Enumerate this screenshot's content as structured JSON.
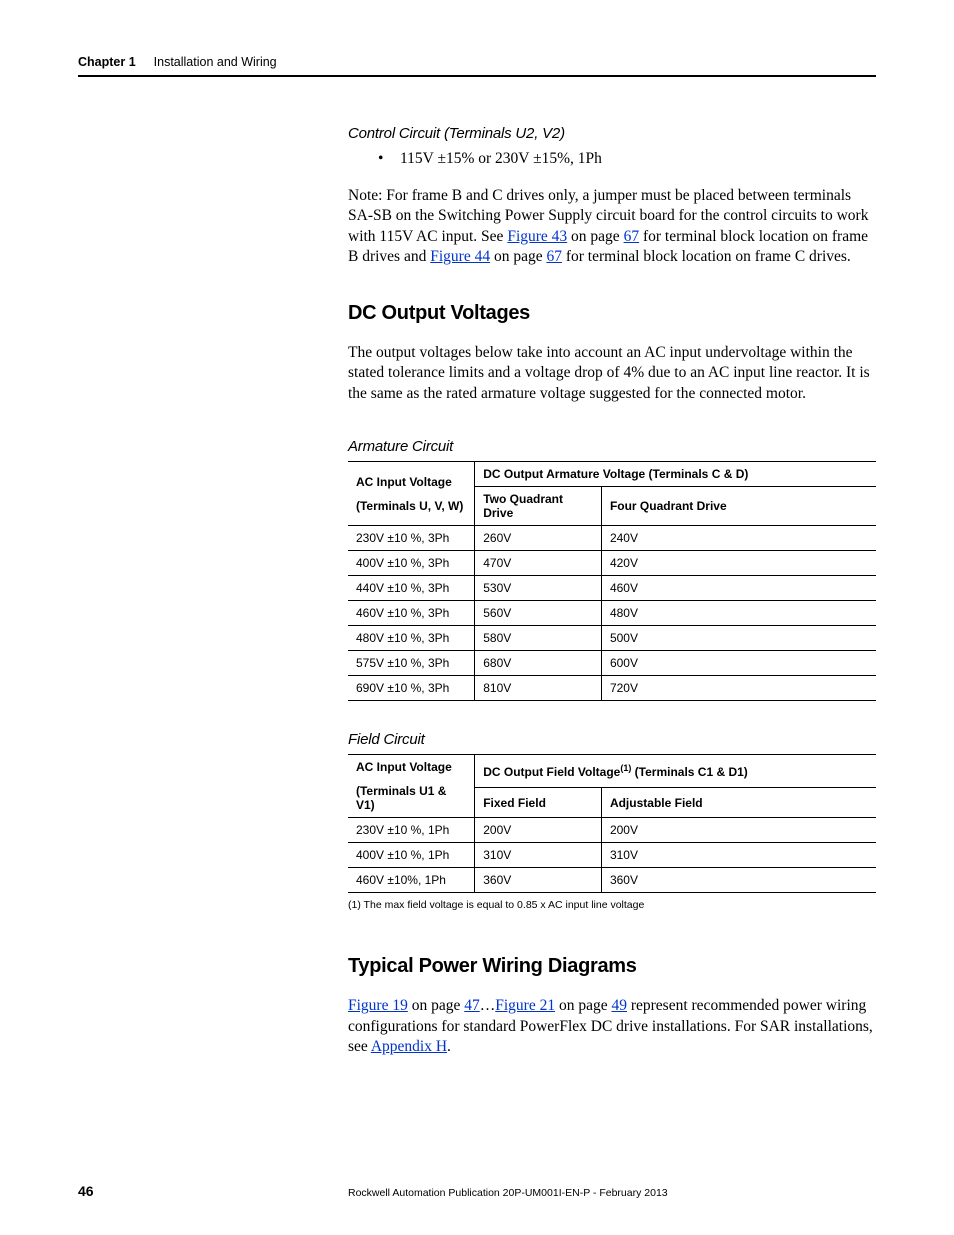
{
  "header": {
    "chapter": "Chapter 1",
    "title": "Installation and Wiring"
  },
  "controlCircuit": {
    "heading": "Control Circuit (Terminals U2, V2)",
    "bullet": "115V ±15% or 230V ±15%, 1Ph"
  },
  "note": {
    "pre1": "Note: For frame B and C drives only, a jumper must be placed between terminals SA-SB on the Switching Power Supply circuit board for the control circuits to work with 115V AC input. See ",
    "link1": "Figure 43",
    "mid1": " on page ",
    "page1": "67",
    "mid2": " for terminal block location on frame B drives and ",
    "link2": "Figure 44",
    "mid3": " on page ",
    "page2": "67",
    "post": " for terminal block location on frame C drives."
  },
  "dcOut": {
    "heading": "DC Output Voltages",
    "para": "The output voltages below take into account an AC input undervoltage within the stated tolerance limits and a voltage drop of 4% due to an AC input line reactor. It is the same as the rated armature voltage suggested for the connected motor."
  },
  "armature": {
    "heading": "Armature Circuit",
    "h1": "AC Input Voltage",
    "h1sub": "(Terminals U, V, W)",
    "h2": "DC Output Armature Voltage (Terminals C & D)",
    "h2a": "Two Quadrant Drive",
    "h2b": "Four Quadrant Drive",
    "rows": [
      {
        "v": "230V ±10 %, 3Ph",
        "a": "260V",
        "b": "240V"
      },
      {
        "v": "400V ±10 %, 3Ph",
        "a": "470V",
        "b": "420V"
      },
      {
        "v": "440V ±10 %, 3Ph",
        "a": "530V",
        "b": "460V"
      },
      {
        "v": "460V ±10 %, 3Ph",
        "a": "560V",
        "b": "480V"
      },
      {
        "v": "480V ±10 %, 3Ph",
        "a": "580V",
        "b": "500V"
      },
      {
        "v": "575V ±10 %, 3Ph",
        "a": "680V",
        "b": "600V"
      },
      {
        "v": "690V ±10 %, 3Ph",
        "a": "810V",
        "b": "720V"
      }
    ]
  },
  "field": {
    "heading": "Field Circuit",
    "h1": "AC Input Voltage",
    "h1sub": "(Terminals U1 & V1)",
    "h2pre": "DC Output Field Voltage",
    "h2sup": "(1)",
    "h2post": " (Terminals C1 & D1)",
    "h2a": "Fixed Field",
    "h2b": "Adjustable Field",
    "rows": [
      {
        "v": "230V ±10 %, 1Ph",
        "a": "200V",
        "b": "200V"
      },
      {
        "v": "400V ±10 %, 1Ph",
        "a": "310V",
        "b": "310V"
      },
      {
        "v": "460V ±10%, 1Ph",
        "a": "360V",
        "b": "360V"
      }
    ],
    "footnote": "(1)   The max field voltage is equal to 0.85 x AC input line voltage"
  },
  "typical": {
    "heading": "Typical Power Wiring Diagrams",
    "link1": "Figure 19",
    "mid1": " on page ",
    "page1": "47",
    "ellipsis": "…",
    "link2": "Figure 21",
    "mid2": " on page ",
    "page2": "49",
    "mid3": " represent recommended power wiring configurations for standard PowerFlex DC drive installations. For SAR installations, see ",
    "link3": "Appendix H",
    "post": "."
  },
  "footer": {
    "page": "46",
    "pub": "Rockwell Automation Publication 20P-UM001I-EN-P - February 2013"
  }
}
